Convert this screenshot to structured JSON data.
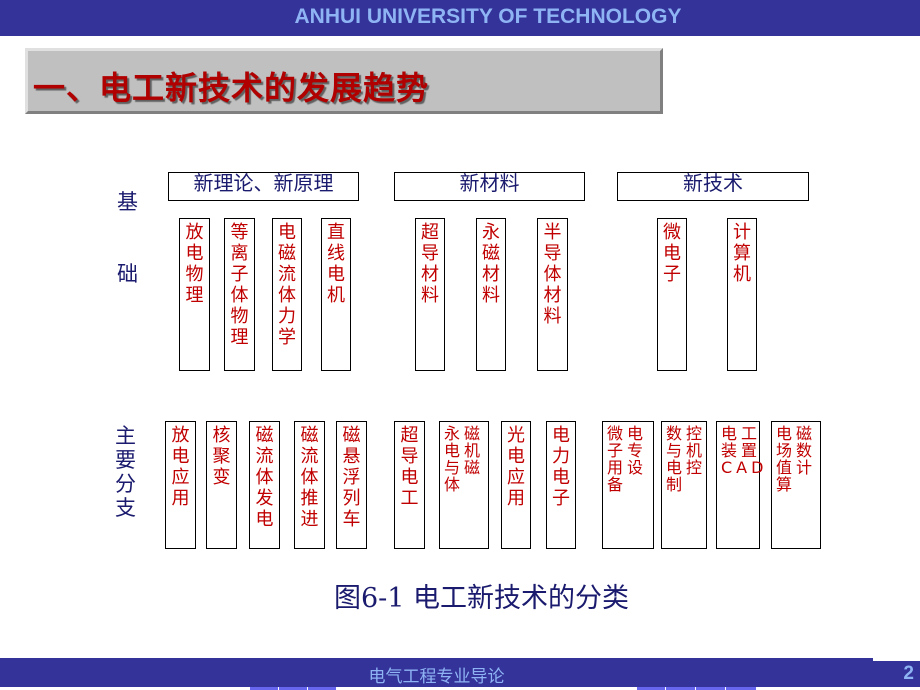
{
  "header": {
    "institution": "ANHUI UNIVERSITY OF TECHNOLOGY"
  },
  "title": "一、电工新技术的发展趋势",
  "labels": {
    "basis": [
      "基",
      "础"
    ],
    "branches": "主\n要\n分\n支"
  },
  "categories": [
    {
      "label": "新理论、新原理"
    },
    {
      "label": "新材料"
    },
    {
      "label": "新技术"
    }
  ],
  "basis_items": [
    {
      "text": "放电物理",
      "category": "新理论、新原理"
    },
    {
      "text": "等离子体物理",
      "category": "新理论、新原理"
    },
    {
      "text": "电磁流体力学",
      "category": "新理论、新原理"
    },
    {
      "text": "直线电机",
      "category": "新理论、新原理"
    },
    {
      "text": "超导材料",
      "category": "新材料"
    },
    {
      "text": "永磁材料",
      "category": "新材料"
    },
    {
      "text": "半导体材料",
      "category": "新材料"
    },
    {
      "text": "微电子",
      "category": "新技术"
    },
    {
      "text": "计算机",
      "category": "新技术"
    }
  ],
  "branch_items": [
    {
      "text": "放电应用"
    },
    {
      "text": "核聚变"
    },
    {
      "text": "磁流体发电"
    },
    {
      "text": "磁流体推进"
    },
    {
      "text": "磁悬浮列车"
    },
    {
      "text": "超导电工"
    },
    {
      "text": "永磁电机与磁体"
    },
    {
      "text": "光电应用"
    },
    {
      "text": "电力电子"
    },
    {
      "text": "微电子专用设备"
    },
    {
      "text": "数控与机电控制"
    },
    {
      "text": "电工装置CAD"
    },
    {
      "text": "电磁场数值计算"
    }
  ],
  "caption": "图6-1 电工新技术的分类",
  "footer": {
    "course": "电气工程专业导论",
    "page_number": "2"
  },
  "colors": {
    "bar": "#333399",
    "bar_text": "#8fb4f4",
    "item_text": "#c00000",
    "label_text": "#1a1a6e",
    "title_text": "#b00000"
  }
}
